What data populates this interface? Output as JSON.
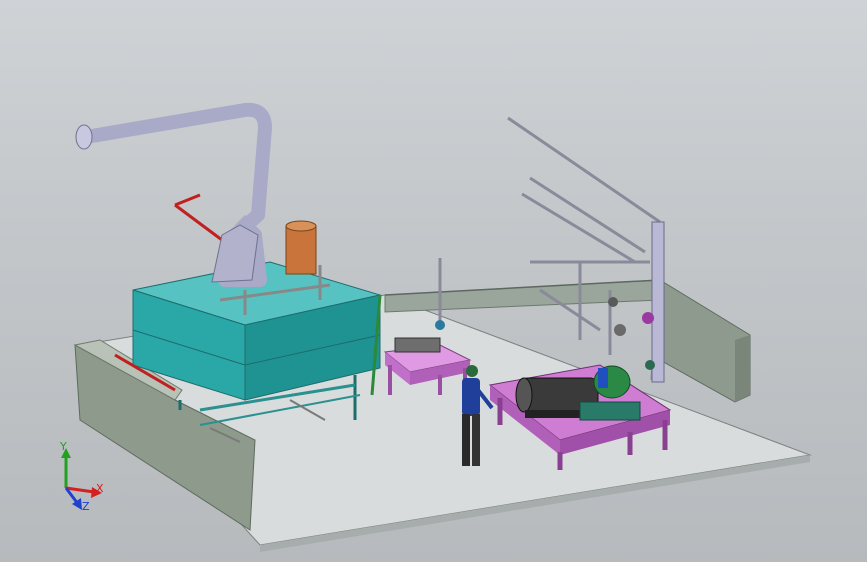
{
  "viewport": {
    "background_top": "#cfd3d6",
    "background_bottom": "#b6babd"
  },
  "scene": {
    "objects": [
      {
        "name": "floor-platform",
        "color": "#d9dcdc"
      },
      {
        "name": "left-wall",
        "color": "#8d9a8c"
      },
      {
        "name": "back-wall",
        "color": "#9aa69b"
      },
      {
        "name": "right-wall",
        "color": "#8e9a8d"
      },
      {
        "name": "tank",
        "color": "#2aa7a7"
      },
      {
        "name": "exhaust-duct",
        "color": "#a9a9c8"
      },
      {
        "name": "orange-vessel",
        "color": "#c8743a"
      },
      {
        "name": "purple-bench-left",
        "color": "#d47fd8"
      },
      {
        "name": "purple-bench-right",
        "color": "#cf7dd2"
      },
      {
        "name": "motor",
        "color": "#3a3a3a"
      },
      {
        "name": "pump-housing",
        "color": "#2a8a45"
      },
      {
        "name": "operator-figure",
        "color": "#1f3f9a"
      }
    ]
  },
  "triad": {
    "x_label": "X",
    "y_label": "Y",
    "z_label": "Z",
    "x_color": "#d42020",
    "y_color": "#22a022",
    "z_color": "#2040d0"
  }
}
